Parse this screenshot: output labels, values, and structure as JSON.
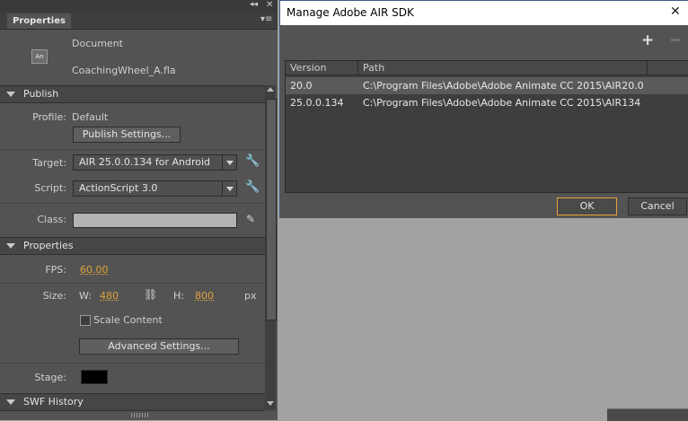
{
  "properties_panel": {
    "tab_label": "Properties",
    "doc_icon_text": "An",
    "doc_type": "Document",
    "doc_name": "CoachingWheel_A.fla",
    "publish": {
      "header": "Publish",
      "profile_label": "Profile:",
      "profile_value": "Default",
      "publish_settings_button": "Publish Settings...",
      "target_label": "Target:",
      "target_value": "AIR 25.0.0.134 for Android",
      "script_label": "Script:",
      "script_value": "ActionScript 3.0",
      "class_label": "Class:",
      "class_value": ""
    },
    "properties": {
      "header": "Properties",
      "fps_label": "FPS:",
      "fps_value": "60.00",
      "size_label": "Size:",
      "w_label": "W:",
      "w_value": "480",
      "h_label": "H:",
      "h_value": "800",
      "unit": "px",
      "scale_content_label": "Scale Content",
      "scale_content_checked": false,
      "advanced_settings_button": "Advanced Settings...",
      "stage_label": "Stage:",
      "stage_color": "#000000"
    },
    "swf_history_header": "SWF History"
  },
  "dialog": {
    "title": "Manage Adobe AIR SDK",
    "add_glyph": "+",
    "remove_glyph": "−",
    "close_glyph": "✕",
    "columns": [
      "Version",
      "Path"
    ],
    "rows": [
      {
        "version": "20.0",
        "path": "C:\\Program Files\\Adobe\\Adobe Animate CC 2015\\AIR20.0",
        "selected": true
      },
      {
        "version": "25.0.0.134",
        "path": "C:\\Program Files\\Adobe\\Adobe Animate CC 2015\\AIR134",
        "selected": false
      }
    ],
    "ok_button": "OK",
    "cancel_button": "Cancel"
  },
  "colors": {
    "accent_orange": "#e0a239",
    "panel_bg": "#535353",
    "background_gray": "#a2a2a2"
  }
}
